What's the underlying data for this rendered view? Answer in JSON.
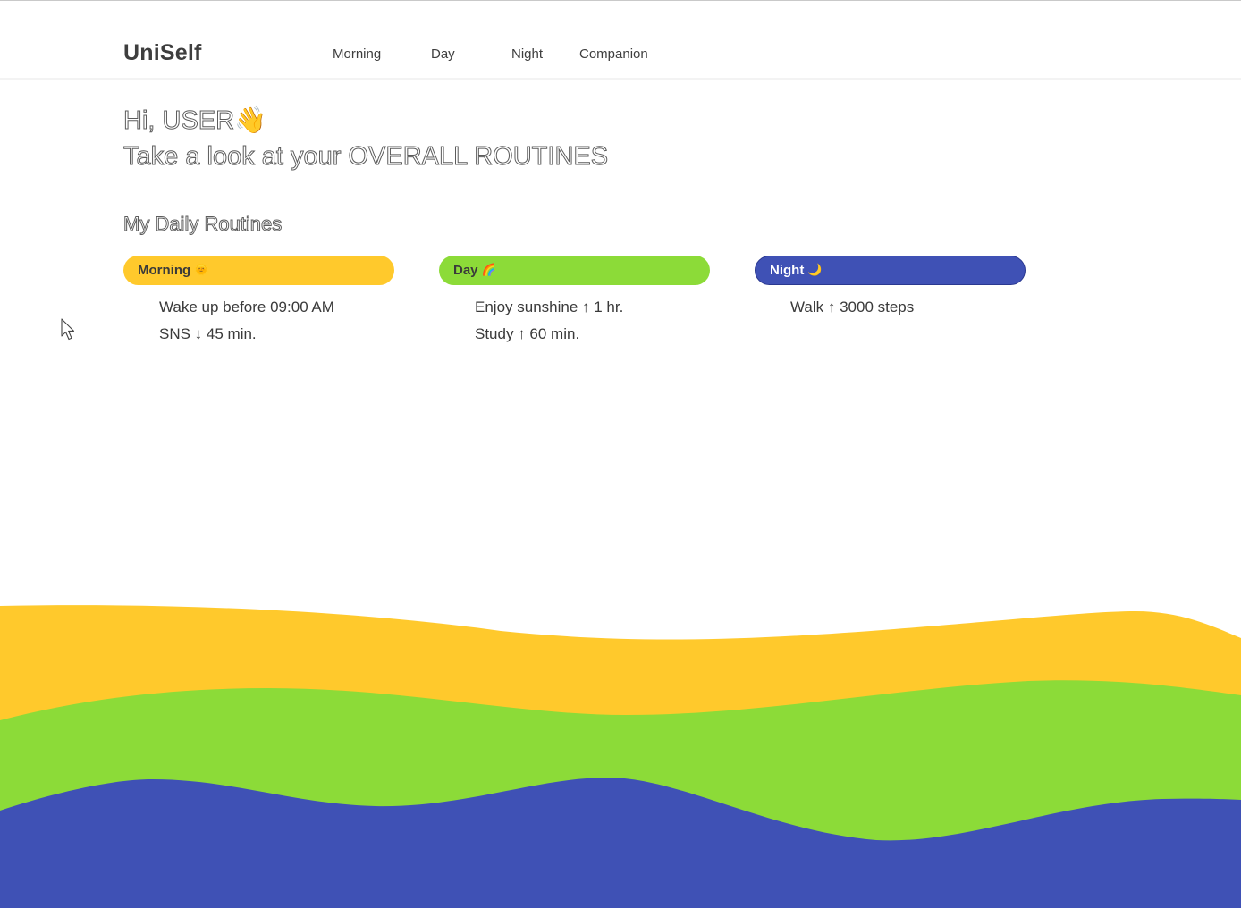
{
  "header": {
    "brand": "UniSelf",
    "nav": [
      "Morning",
      "Day",
      "Night",
      "Companion"
    ]
  },
  "greeting": {
    "hi": "Hi, USER",
    "wave_emoji": "👋",
    "headline": "Take a look at your OVERALL ROUTINES"
  },
  "routines": {
    "title": "My Daily Routines",
    "categories": [
      {
        "label": "Morning",
        "emoji": "🌞",
        "color": "#ffc92c",
        "items": [
          "Wake up before 09:00 AM",
          "SNS ↓ 45 min."
        ]
      },
      {
        "label": "Day",
        "emoji": "🌈",
        "color": "#8cdb38",
        "items": [
          "Enjoy sunshine ↑ 1 hr.",
          "Study ↑ 60 min."
        ]
      },
      {
        "label": "Night",
        "emoji": "🌙",
        "color": "#3f51b5",
        "items": [
          "Walk ↑ 3000 steps"
        ]
      }
    ]
  },
  "icons": {
    "cursor": "mouse-pointer-icon"
  },
  "colors": {
    "morning": "#ffc92c",
    "day": "#8cdb38",
    "night": "#3f51b5"
  }
}
